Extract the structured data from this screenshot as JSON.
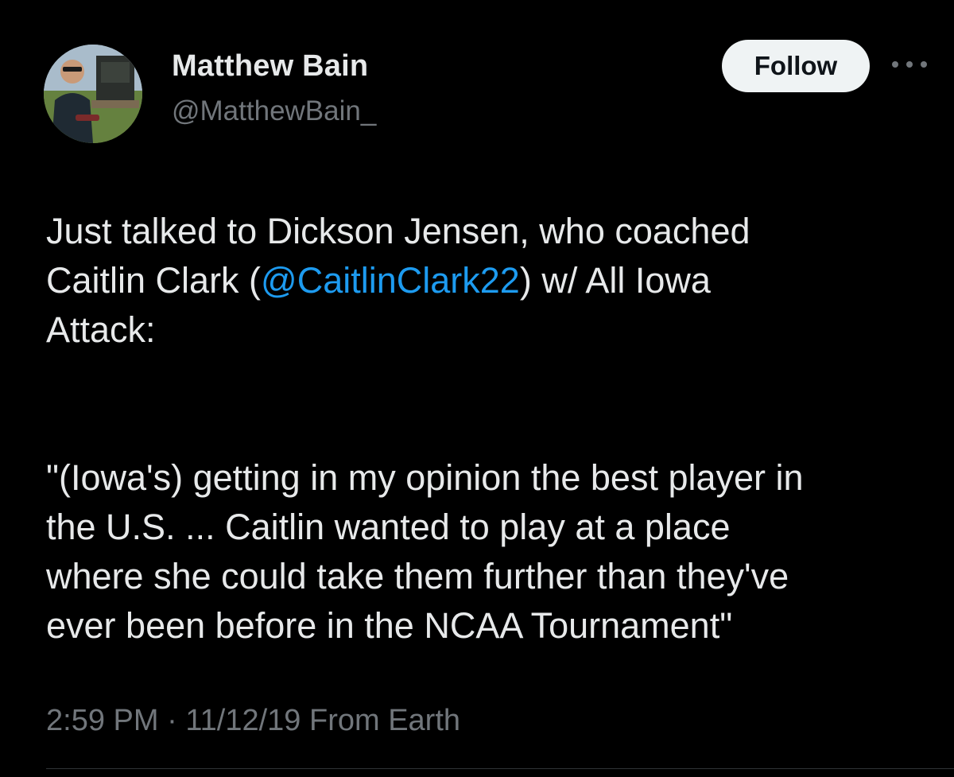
{
  "author": {
    "name": "Matthew Bain",
    "handle": "@MatthewBain_",
    "avatar_icon": "profile-photo-icon"
  },
  "actions": {
    "follow_label": "Follow",
    "more_icon": "more-options-icon"
  },
  "tweet": {
    "line1_part1": "Just talked to Dickson Jensen, who coached",
    "line2_part1": "Caitlin Clark (",
    "mention": "@CaitlinClark22",
    "line2_part2": ") w/ All Iowa",
    "line3": "Attack:",
    "quote_line1": "\"(Iowa's) getting in my opinion the best player in",
    "quote_line2": "the U.S. ... Caitlin wanted to play at a place",
    "quote_line3": "where she could take them further than they've",
    "quote_line4": "ever been before in the NCAA Tournament\""
  },
  "meta": {
    "time": "2:59 PM",
    "separator": " · ",
    "date": "11/12/19",
    "source": "From Earth"
  },
  "colors": {
    "background": "#000000",
    "text": "#e7e9ea",
    "secondary": "#71767b",
    "link": "#1d9bf0",
    "button_bg": "#eff3f4"
  }
}
